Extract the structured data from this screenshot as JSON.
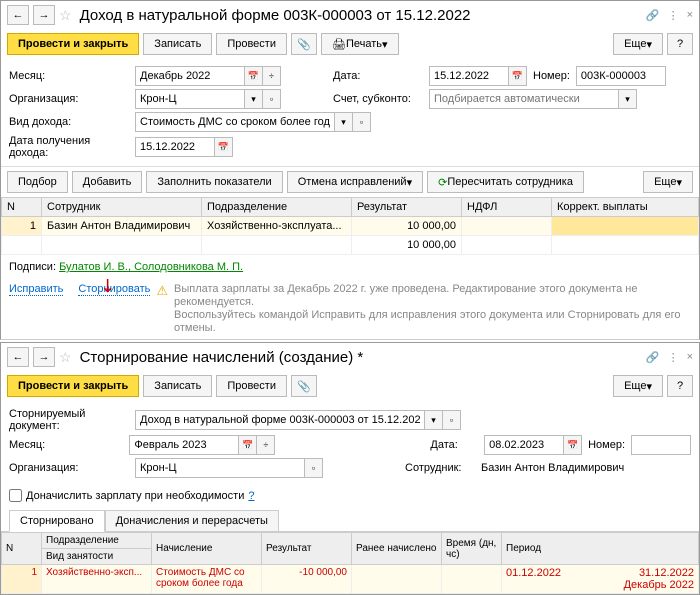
{
  "w1": {
    "title": "Доход в натуральной форме 003К-000003 от 15.12.2022",
    "toolbar": {
      "execute_close": "Провести и закрыть",
      "save": "Записать",
      "execute": "Провести",
      "print": "Печать",
      "more": "Еще"
    },
    "form": {
      "month_lbl": "Месяц:",
      "month_val": "Декабрь 2022",
      "org_lbl": "Организация:",
      "org_val": "Крон-Ц",
      "type_lbl": "Вид дохода:",
      "type_val": "Стоимость ДМС со сроком более года",
      "recv_lbl": "Дата получения дохода:",
      "recv_val": "15.12.2022",
      "date_lbl": "Дата:",
      "date_val": "15.12.2022",
      "num_lbl": "Номер:",
      "num_val": "003К-000003",
      "acct_lbl": "Счет, субконто:",
      "acct_ph": "Подбирается автоматически"
    },
    "tbl_tb": {
      "pick": "Подбор",
      "add": "Добавить",
      "fill": "Заполнить показатели",
      "cancel": "Отмена исправлений",
      "recalc": "Пересчитать сотрудника",
      "more": "Еще"
    },
    "th": {
      "n": "N",
      "emp": "Сотрудник",
      "dept": "Подразделение",
      "res": "Результат",
      "ndfl": "НДФЛ",
      "corr": "Коррект. выплаты"
    },
    "row": {
      "n": "1",
      "emp": "Базин Антон Владимирович",
      "dept": "Хозяйственно-эксплуата...",
      "res": "10 000,00"
    },
    "total": "10 000,00",
    "signers_lbl": "Подписи:",
    "signers": "Булатов И. В., Солодовникова М. П.",
    "fix": "Исправить",
    "reverse": "Сторнировать",
    "warn1": "Выплата зарплаты за Декабрь 2022 г. уже проведена. Редактирование этого документа не рекомендуется.",
    "warn2": "Воспользуйтесь командой Исправить для исправления этого документа или Сторнировать для его отмены."
  },
  "w2": {
    "title": "Сторнирование начислений (создание) *",
    "toolbar": {
      "execute_close": "Провести и закрыть",
      "save": "Записать",
      "execute": "Провести",
      "more": "Еще"
    },
    "form": {
      "doc_lbl": "Сторнируемый документ:",
      "doc_val": "Доход в натуральной форме 003К-000003 от 15.12.2022",
      "month_lbl": "Месяц:",
      "month_val": "Февраль 2023",
      "org_lbl": "Организация:",
      "org_val": "Крон-Ц",
      "date_lbl": "Дата:",
      "date_val": "08.02.2023",
      "num_lbl": "Номер:",
      "emp_lbl": "Сотрудник:",
      "emp_val": "Базин Антон Владимирович",
      "chk_lbl": "Доначислить зарплату при необходимости"
    },
    "tabs": {
      "t1": "Сторнировано",
      "t2": "Доначисления и перерасчеты"
    },
    "th": {
      "n": "N",
      "dept": "Подразделение",
      "emp_type": "Вид занятости",
      "accr": "Начисление",
      "res": "Результат",
      "prev": "Ранее начислено",
      "time": "Время (дн, чс)",
      "period": "Период"
    },
    "row": {
      "n": "1",
      "dept": "Хозяйственно-эксп...",
      "accr": "Стоимость ДМС со сроком более года",
      "res": "-10 000,00",
      "p_start": "01.12.2022",
      "p_end": "31.12.2022",
      "p_month": "Декабрь 2022"
    }
  }
}
